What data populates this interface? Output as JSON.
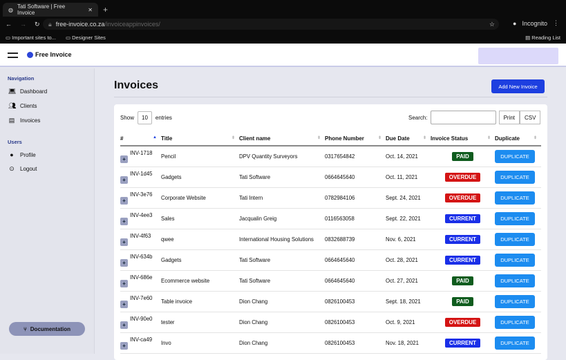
{
  "browser": {
    "tab_title": "Tati Software | Free Invoice",
    "url_host": "free-invoice.co.za",
    "url_path": "/invoiceappinvoices/",
    "profile": "Incognito",
    "bookmarks": [
      "Important sites to...",
      "Designer Sites"
    ],
    "reading_list": "Reading List"
  },
  "app": {
    "logo": "Free Invoice"
  },
  "sidebar": {
    "nav_heading": "Navigation",
    "nav": [
      {
        "label": "Dashboard",
        "icon": "laptop-icon"
      },
      {
        "label": "Clients",
        "icon": "users-icon"
      },
      {
        "label": "Invoices",
        "icon": "document-icon"
      }
    ],
    "users_heading": "Users",
    "users": [
      {
        "label": "Profile",
        "icon": "user-icon"
      },
      {
        "label": "Logout",
        "icon": "toggle-icon"
      }
    ],
    "documentation": "Documentation"
  },
  "main": {
    "title": "Invoices",
    "add_button": "Add New Invoice",
    "show_label": "Show",
    "entries_value": "10",
    "entries_label": "entries",
    "search_label": "Search:",
    "search_value": "",
    "print": "Print",
    "csv": "CSV",
    "columns": [
      "#",
      "Title",
      "Client name",
      "Phone Number",
      "Due Date",
      "Invoice Status",
      "Duplicate"
    ],
    "rows": [
      {
        "id": "INV-1718",
        "title": "Pencil",
        "client": "DPV Quantity Surveyors",
        "phone": "0317654842",
        "due": "Oct. 14, 2021",
        "status": "PAID",
        "action": "DUPLICATE"
      },
      {
        "id": "INV-1d45",
        "title": "Gadgets",
        "client": "Tati Software",
        "phone": "0664645640",
        "due": "Oct. 11, 2021",
        "status": "OVERDUE",
        "action": "DUPLICATE"
      },
      {
        "id": "INV-3e76",
        "title": "Corporate Website",
        "client": "Tati Intern",
        "phone": "0782984106",
        "due": "Sept. 24, 2021",
        "status": "OVERDUE",
        "action": "DUPLICATE"
      },
      {
        "id": "INV-4ee3",
        "title": "Sales",
        "client": "Jacqualin Greig",
        "phone": "0116563058",
        "due": "Sept. 22, 2021",
        "status": "CURRENT",
        "action": "DUPLICATE"
      },
      {
        "id": "INV-4f63",
        "title": "qwee",
        "client": "International Housing Solutions",
        "phone": "0832688739",
        "due": "Nov. 6, 2021",
        "status": "CURRENT",
        "action": "DUPLICATE"
      },
      {
        "id": "INV-634b",
        "title": "Gadgets",
        "client": "Tati Software",
        "phone": "0664645640",
        "due": "Oct. 28, 2021",
        "status": "CURRENT",
        "action": "DUPLICATE"
      },
      {
        "id": "INV-686e",
        "title": "Ecommerce website",
        "client": "Tati Software",
        "phone": "0664645640",
        "due": "Oct. 27, 2021",
        "status": "PAID",
        "action": "DUPLICATE"
      },
      {
        "id": "INV-7e60",
        "title": "Table invoice",
        "client": "Dion Chang",
        "phone": "0826100453",
        "due": "Sept. 18, 2021",
        "status": "PAID",
        "action": "DUPLICATE"
      },
      {
        "id": "INV-90e0",
        "title": "tester",
        "client": "Dion Chang",
        "phone": "0826100453",
        "due": "Oct. 9, 2021",
        "status": "OVERDUE",
        "action": "DUPLICATE"
      },
      {
        "id": "INV-ca49",
        "title": "Invo",
        "client": "Dion Chang",
        "phone": "0826100453",
        "due": "Nov. 18, 2021",
        "status": "CURRENT",
        "action": "DUPLICATE"
      }
    ]
  },
  "status_colors": {
    "PAID": "#0f5c1e",
    "OVERDUE": "#d41414",
    "CURRENT": "#1a2fe8"
  }
}
